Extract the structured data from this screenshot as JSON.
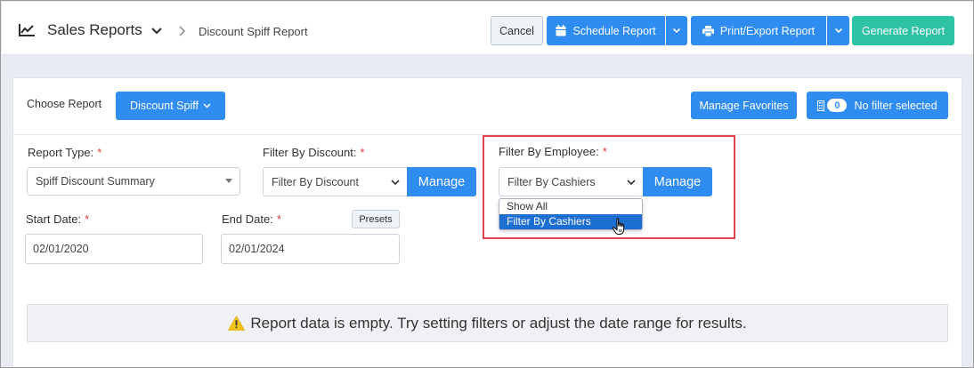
{
  "header": {
    "title": "Sales Reports",
    "breadcrumb": "Discount Spiff Report",
    "cancel_label": "Cancel",
    "schedule_label": "Schedule Report",
    "print_label": "Print/Export Report",
    "generate_label": "Generate Report"
  },
  "toolbar": {
    "choose_label": "Choose Report",
    "choose_value": "Discount Spiff",
    "favorites_label": "Manage Favorites",
    "filter_count": "0",
    "filter_label": "No filter selected"
  },
  "form": {
    "report_type": {
      "label": "Report Type:",
      "required": "*",
      "value": "Spiff Discount Summary"
    },
    "filter_discount": {
      "label": "Filter By Discount:",
      "required": "*",
      "value": "Filter By Discount",
      "manage_label": "Manage"
    },
    "filter_employee": {
      "label": "Filter By Employee:",
      "required": "*",
      "value": "Filter By Cashiers",
      "manage_label": "Manage",
      "options": [
        "Show All",
        "Filter By Cashiers"
      ],
      "selected_option": "Filter By Cashiers"
    },
    "start_date": {
      "label": "Start Date:",
      "required": "*",
      "value": "02/01/2020"
    },
    "end_date": {
      "label": "End Date:",
      "required": "*",
      "value": "02/01/2024"
    },
    "presets_label": "Presets"
  },
  "alert": {
    "message": "Report data is empty. Try setting filters or adjust the date range for results."
  },
  "colors": {
    "primary": "#2f8cf0",
    "success": "#2ec2a4",
    "highlight": "#e0474c",
    "warning": "#f5c518",
    "required": "#e03c3c"
  },
  "icons": {
    "title": "line-chart-icon",
    "schedule": "calendar-icon",
    "print": "printer-icon",
    "filter": "filter-icon",
    "alert": "warning-icon"
  }
}
